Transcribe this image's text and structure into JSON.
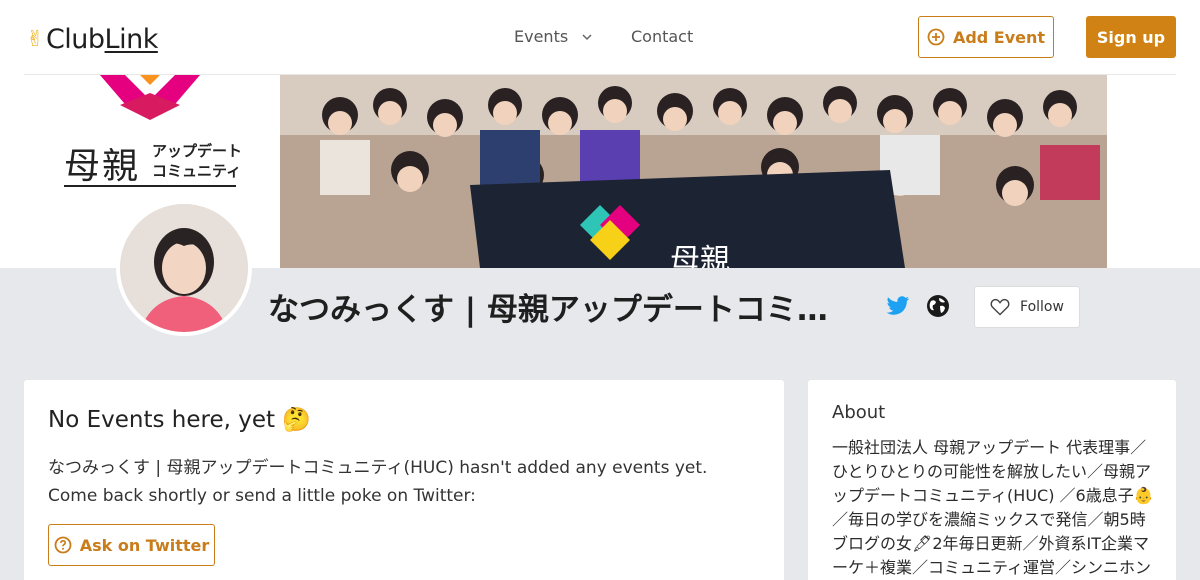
{
  "header": {
    "logo_text": "ClubLink",
    "logo_part_a": "Club",
    "logo_part_b": "Link",
    "logo_icon": "victory-hand-icon",
    "nav": {
      "events_label": "Events",
      "contact_label": "Contact"
    },
    "add_event_label": "Add Event",
    "signup_label": "Sign up"
  },
  "banner": {
    "brand_jp": "母親",
    "brand_sub_line1": "アップデート",
    "brand_sub_line2": "コミュニティ",
    "flag_text": "母親"
  },
  "profile": {
    "name": "なつみっくす | 母親アップデートコミュニティ(HUC)",
    "follow_label": "Follow",
    "links": [
      "twitter-icon",
      "globe-icon"
    ]
  },
  "events_card": {
    "title": "No Events here, yet 🤔",
    "message": "なつみっくす | 母親アップデートコミュニティ(HUC) hasn't added any events yet. Come back shortly or send a little poke on Twitter:",
    "ask_label": "Ask on Twitter"
  },
  "about_card": {
    "title": "About",
    "text": "一般社団法人 母親アップデート 代表理事／ひとりひとりの可能性を解放したい／母親アップデートコミュニティ(HUC) ／6歳息子👶／毎日の学びを濃縮ミックスで発信／朝5時ブログの女🖋2年毎日更新／外資系IT企業マーケ＋複業／コミュニティ運営／シンニホン"
  },
  "colors": {
    "accent": "#c97d1a",
    "accent_fill": "#d08314",
    "twitter": "#1da1f2",
    "page_bg": "#e6e8ec"
  }
}
